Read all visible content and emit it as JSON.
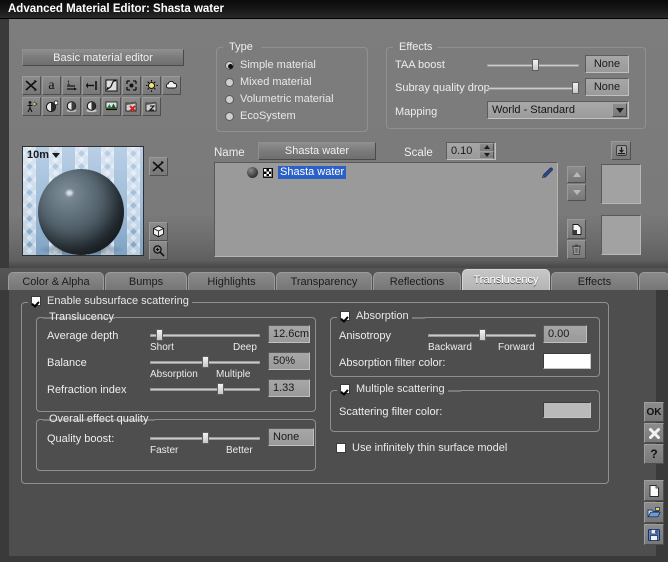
{
  "window": {
    "title": "Advanced Material Editor: Shasta water"
  },
  "toolbar": {
    "basic_editor_label": "Basic material editor",
    "row1_icons": [
      "shuffle-icon",
      "text-a-icon",
      "sort-ascending-icon",
      "align-right-icon",
      "curve-editor-icon",
      "bounding-box-icon",
      "light-bulb-icon",
      "cloud-icon"
    ],
    "row2_icons": [
      "person-light-icon",
      "sphere-shading-icon",
      "material-ball-icon",
      "material-ball-alt-icon",
      "terrain-icon",
      "animation-delete-icon",
      "animation-edit-icon"
    ]
  },
  "type_group": {
    "title": "Type",
    "options": [
      {
        "label": "Simple material",
        "selected": true
      },
      {
        "label": "Mixed material",
        "selected": false
      },
      {
        "label": "Volumetric material",
        "selected": false
      },
      {
        "label": "EcoSystem",
        "selected": false
      }
    ]
  },
  "effects_group": {
    "title": "Effects",
    "taa_boost": {
      "label": "TAA boost",
      "value": "None",
      "slider_percent": 52
    },
    "subray_quality_drop": {
      "label": "Subray quality drop",
      "value": "None",
      "slider_percent": 96
    },
    "mapping": {
      "label": "Mapping",
      "value": "World - Standard"
    }
  },
  "preview": {
    "scale_label": "10m",
    "randomize_icon": "shuffle-icon",
    "shape_icon": "cube-icon",
    "zoom_icon": "magnifier-plus-icon"
  },
  "material_header": {
    "name_label": "Name",
    "name_value": "Shasta water",
    "scale_label": "Scale",
    "scale_value": "0.10",
    "import_icon": "import-icon"
  },
  "material_list": {
    "rows": [
      {
        "label": "Shasta water",
        "selected": true,
        "icons": [
          "sphere-icon",
          "checker-icon"
        ]
      }
    ],
    "edit_icon": "pencil-icon",
    "move_up_icon": "arrow-up-icon",
    "move_down_icon": "arrow-down-icon",
    "duplicate_icon": "copy-icon",
    "delete_icon": "trash-icon"
  },
  "tabs": [
    {
      "label": "Color & Alpha",
      "active": false
    },
    {
      "label": "Bumps",
      "active": false
    },
    {
      "label": "Highlights",
      "active": false
    },
    {
      "label": "Transparency",
      "active": false
    },
    {
      "label": "Reflections",
      "active": false
    },
    {
      "label": "Translucency",
      "active": true
    },
    {
      "label": "Effects",
      "active": false
    }
  ],
  "panel": {
    "enable_sss": {
      "label": "Enable subsurface scattering",
      "checked": true
    },
    "translucency": {
      "title": "Translucency",
      "average_depth": {
        "label": "Average depth",
        "value": "12.6cm",
        "slider_percent": 8,
        "min_label": "Short",
        "max_label": "Deep"
      },
      "balance": {
        "label": "Balance",
        "value": "50%",
        "slider_percent": 50,
        "min_label": "Absorption",
        "max_label": "Multiple"
      },
      "refraction_index": {
        "label": "Refraction index",
        "value": "1.33",
        "slider_percent": 64
      }
    },
    "overall_effect_quality": {
      "title": "Overall effect quality",
      "quality_boost": {
        "label": "Quality boost:",
        "value": "None",
        "slider_percent": 50,
        "min_label": "Faster",
        "max_label": "Better"
      }
    },
    "absorption": {
      "title": "Absorption",
      "checked": true,
      "anisotropy": {
        "label": "Anisotropy",
        "value": "0.00",
        "slider_percent": 50,
        "min_label": "Backward",
        "max_label": "Forward"
      },
      "filter_color": {
        "label": "Absorption filter color:",
        "color": "#ffffff"
      }
    },
    "multiple_scattering": {
      "title": "Multiple scattering",
      "checked": true,
      "filter_color": {
        "label": "Scattering filter color:",
        "color": "#b9b9b9"
      }
    },
    "thin_surface": {
      "label": "Use infinitely thin surface model",
      "checked": false
    }
  },
  "side_buttons": {
    "ok": {
      "label": "OK",
      "icon": "ok-icon"
    },
    "cancel": {
      "label": "",
      "icon": "close-x-icon"
    },
    "help": {
      "label": "?",
      "icon": "question-mark-icon"
    },
    "new": {
      "label": "",
      "icon": "new-document-icon"
    },
    "open": {
      "label": "",
      "icon": "open-folder-icon"
    },
    "save": {
      "label": "",
      "icon": "save-disk-icon"
    }
  },
  "colors": {
    "selection_blue": "#2b60c8",
    "panel_gray": "#4e4e4e",
    "top_gray": "#7a7a7a"
  }
}
